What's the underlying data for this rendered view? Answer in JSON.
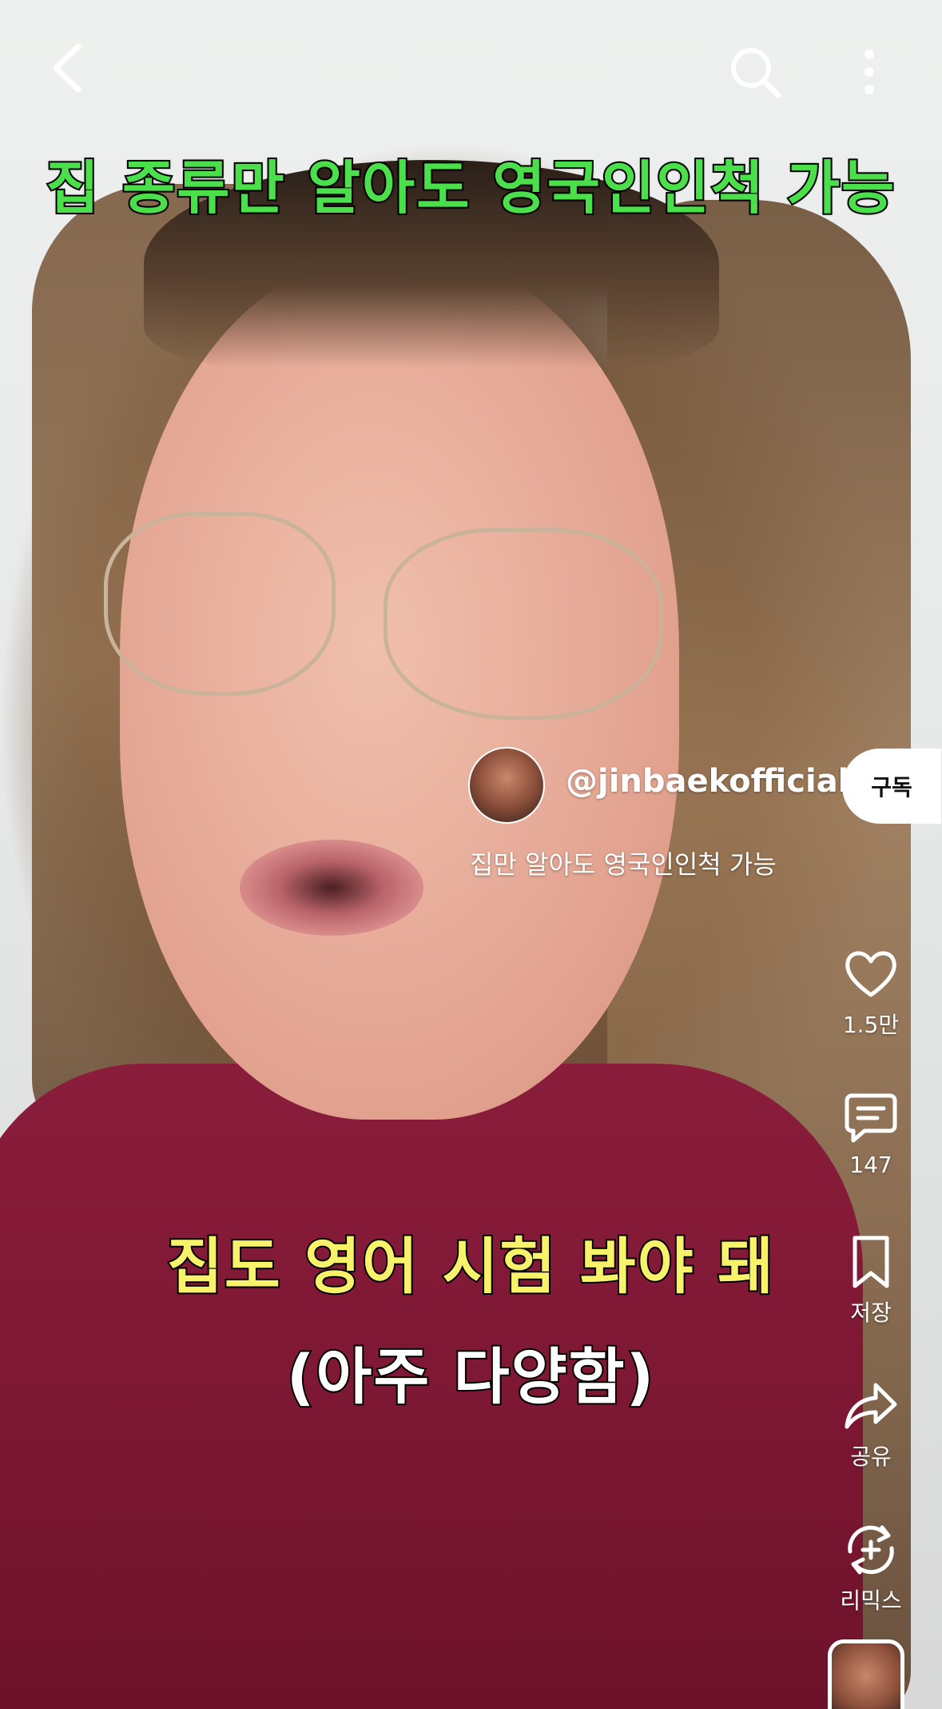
{
  "top_bar": {
    "back_icon": "back-arrow-icon",
    "search_icon": "search-icon",
    "more_icon": "more-vertical-icon"
  },
  "video": {
    "overlay_title": "집 종류만 알아도 영국인인척 가능",
    "caption_line1": "집도 영어 시험 봐야 돼",
    "caption_line2": "(아주 다양함)"
  },
  "channel": {
    "handle": "@jinbaekofficial",
    "subscribe_label": "구독",
    "description": "집만 알아도 영국인인척 가능"
  },
  "actions": {
    "like": {
      "icon": "heart-icon",
      "label": "1.5만"
    },
    "comment": {
      "icon": "comment-icon",
      "label": "147"
    },
    "save": {
      "icon": "bookmark-icon",
      "label": "저장"
    },
    "share": {
      "icon": "share-icon",
      "label": "공유"
    },
    "remix": {
      "icon": "remix-icon",
      "label": "리믹스"
    }
  },
  "colors": {
    "title_green": "#4be04b",
    "caption_yellow": "#f7f26a",
    "subscribe_bg": "#ffffff"
  }
}
